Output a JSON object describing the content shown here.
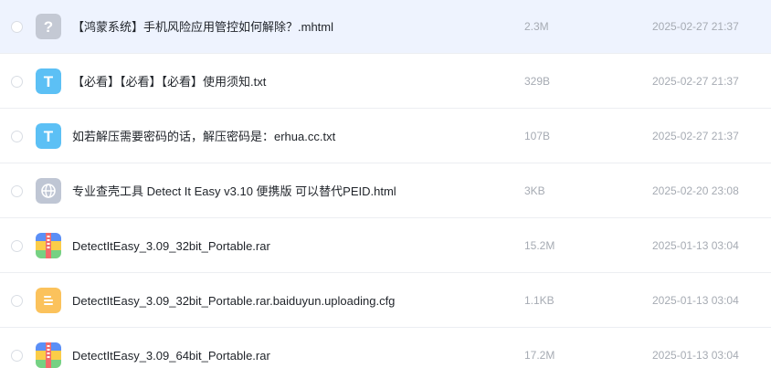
{
  "files": [
    {
      "name": "【鸿蒙系统】手机风险应用管控如何解除？.mhtml",
      "size": "2.3M",
      "date": "2025-02-27 21:37",
      "icon": "unknown-file-icon",
      "selected": true
    },
    {
      "name": "【必看】【必看】【必看】使用须知.txt",
      "size": "329B",
      "date": "2025-02-27 21:37",
      "icon": "text-file-icon",
      "selected": false
    },
    {
      "name": "如若解压需要密码的话，解压密码是：erhua.cc.txt",
      "size": "107B",
      "date": "2025-02-27 21:37",
      "icon": "text-file-icon",
      "selected": false
    },
    {
      "name": "专业查壳工具 Detect It Easy v3.10 便携版 可以替代PEID.html",
      "size": "3KB",
      "date": "2025-02-20 23:08",
      "icon": "web-file-icon",
      "selected": false
    },
    {
      "name": "DetectItEasy_3.09_32bit_Portable.rar",
      "size": "15.2M",
      "date": "2025-01-13 03:04",
      "icon": "archive-file-icon",
      "selected": false
    },
    {
      "name": "DetectItEasy_3.09_32bit_Portable.rar.baiduyun.uploading.cfg",
      "size": "1.1KB",
      "date": "2025-01-13 03:04",
      "icon": "document-file-icon",
      "selected": false
    },
    {
      "name": "DetectItEasy_3.09_64bit_Portable.rar",
      "size": "17.2M",
      "date": "2025-01-13 03:04",
      "icon": "archive-file-icon",
      "selected": false
    }
  ],
  "colors": {
    "selected_row": "#eef3fe",
    "text_icon": "#5cc0f5",
    "unknown_icon": "#c4c9d4",
    "web_icon": "#bfc6d4",
    "document_icon": "#fbc25c",
    "archive_blue": "#5b8ff6",
    "archive_yellow": "#fbcd48",
    "archive_green": "#76d183",
    "archive_red": "#f26a6a"
  }
}
